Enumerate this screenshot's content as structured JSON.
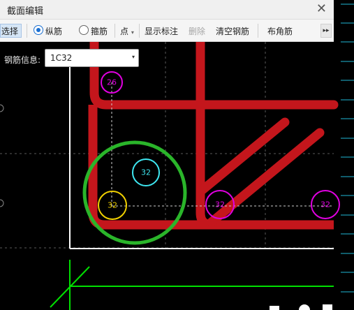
{
  "window": {
    "title": "截面编辑",
    "close_glyph": "✕"
  },
  "toolbar": {
    "select_label": "选择",
    "radio_longitudinal": "纵筋",
    "radio_stirrup": "箍筋",
    "point_label": "点",
    "point_caret": "▾",
    "show_annotation": "显示标注",
    "delete_label": "删除",
    "clear_rebar": "清空钢筋",
    "corner_rebar": "布角筋",
    "more_glyph": "▸▸"
  },
  "info": {
    "label": "钢筋信息:",
    "value": "1C32",
    "arrow": "▾"
  },
  "rebars": [
    {
      "label": "26",
      "color": "#e000e0"
    },
    {
      "label": "32",
      "color": "#3ee6f0"
    },
    {
      "label": "32",
      "color": "#f0d000"
    },
    {
      "label": "32",
      "color": "#e000e0"
    },
    {
      "label": "32",
      "color": "#e000e0"
    }
  ],
  "colors": {
    "stirrup": "#c4161c",
    "highlight": "#2ab52a",
    "axis": "#00e000",
    "outline": "#ffffff",
    "accent": "#1a6fd1"
  }
}
